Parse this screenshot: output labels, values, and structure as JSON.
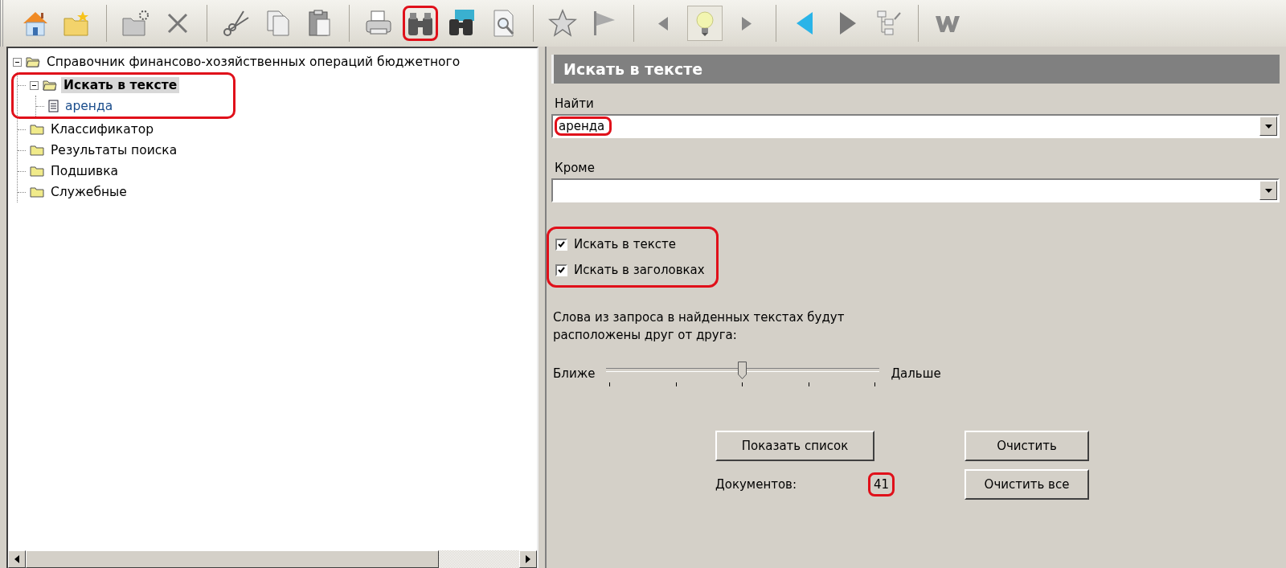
{
  "toolbar": [
    {
      "kind": "home"
    },
    {
      "kind": "favorite-folder"
    },
    {
      "kind": "separator"
    },
    {
      "kind": "new-folder"
    },
    {
      "kind": "delete"
    },
    {
      "kind": "separator"
    },
    {
      "kind": "cut"
    },
    {
      "kind": "copy"
    },
    {
      "kind": "paste"
    },
    {
      "kind": "separator"
    },
    {
      "kind": "print"
    },
    {
      "kind": "find",
      "annotated": true
    },
    {
      "kind": "find-multi"
    },
    {
      "kind": "preview"
    },
    {
      "kind": "separator"
    },
    {
      "kind": "star"
    },
    {
      "kind": "flag"
    },
    {
      "kind": "separator"
    },
    {
      "kind": "prev-small"
    },
    {
      "kind": "bulb",
      "pressed": true
    },
    {
      "kind": "next-small"
    },
    {
      "kind": "separator"
    },
    {
      "kind": "back"
    },
    {
      "kind": "forward"
    },
    {
      "kind": "tree"
    },
    {
      "kind": "separator"
    },
    {
      "kind": "word"
    }
  ],
  "tree": {
    "label": "Справочник финансово-хозяйственных операций бюджетного",
    "kind": "folder",
    "expanded": true,
    "children": [
      {
        "label": "Искать в тексте",
        "kind": "folder",
        "expanded": true,
        "selected": true,
        "annotated": true,
        "children": [
          {
            "label": "аренда",
            "kind": "document",
            "selected": false
          }
        ]
      },
      {
        "label": "Классификатор",
        "kind": "folder",
        "selected": false
      },
      {
        "label": "Результаты поиска",
        "kind": "folder",
        "selected": false
      },
      {
        "label": "Подшивка",
        "kind": "folder",
        "selected": false
      },
      {
        "label": "Служебные",
        "kind": "folder",
        "selected": false
      }
    ]
  },
  "panel": {
    "title": "Искать в тексте",
    "find": {
      "label": "Найти",
      "value": "аренда",
      "annotated": true
    },
    "except": {
      "label": "Кроме"
    },
    "options": {
      "annotated": true,
      "items": [
        {
          "label": "Искать в тексте",
          "checked": true
        },
        {
          "label": "Искать в заголовках",
          "checked": true
        }
      ]
    },
    "distance": {
      "label": "Слова из запроса в найденных текстах будут расположены друг от друга:",
      "min_label": "Ближе",
      "max_label": "Дальше",
      "level": 0.5
    },
    "buttons": [
      {
        "label": "Показать список"
      },
      {
        "label": "Очистить"
      },
      {
        "label": "Очистить все"
      }
    ],
    "count": {
      "label": "Документов:",
      "value": "41",
      "annotated": true
    }
  }
}
